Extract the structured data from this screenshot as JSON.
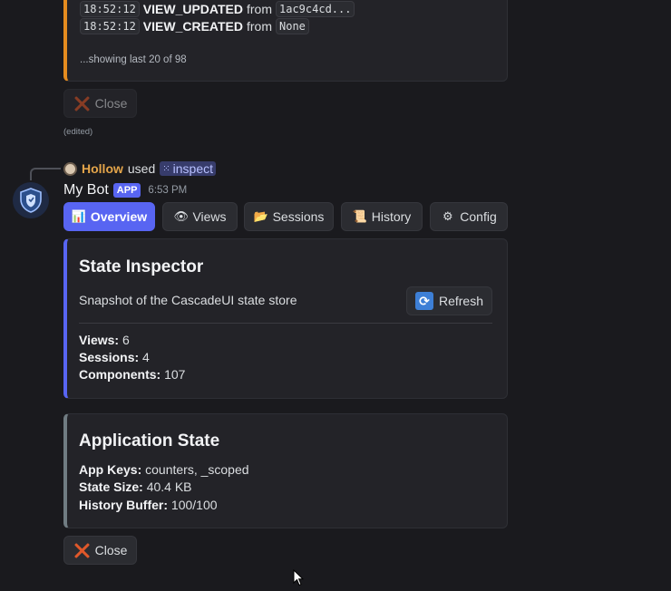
{
  "prev_embed": {
    "log": [
      {
        "time": "18:52:12",
        "event": "VIEW_UPDATED",
        "from": "from",
        "ref": "1ac9c4cd..."
      },
      {
        "time": "18:52:12",
        "event": "VIEW_CREATED",
        "from": "from",
        "ref": "None"
      }
    ],
    "showing": "...showing last 20 of 98",
    "close_label": "Close",
    "edited": "(edited)"
  },
  "reply": {
    "user": "Hollow",
    "used": "used",
    "command": "inspect"
  },
  "bot": {
    "name": "My Bot",
    "badge": "APP",
    "time": "6:53 PM"
  },
  "tabs": [
    {
      "label": "Overview",
      "icon": "bar-chart-icon",
      "active": true
    },
    {
      "label": "Views",
      "icon": "eye-icon",
      "active": false
    },
    {
      "label": "Sessions",
      "icon": "folder-icon",
      "active": false
    },
    {
      "label": "History",
      "icon": "scroll-icon",
      "active": false
    },
    {
      "label": "Config",
      "icon": "gear-icon",
      "active": false
    }
  ],
  "state_inspector": {
    "title": "State Inspector",
    "description": "Snapshot of the CascadeUI state store",
    "refresh_label": "Refresh",
    "fields": [
      {
        "label": "Views:",
        "value": "6"
      },
      {
        "label": "Sessions:",
        "value": "4"
      },
      {
        "label": "Components:",
        "value": "107"
      }
    ]
  },
  "application_state": {
    "title": "Application State",
    "fields": [
      {
        "label": "App Keys:",
        "value": "counters, _scoped"
      },
      {
        "label": "State Size:",
        "value": "40.4 KB"
      },
      {
        "label": "History Buffer:",
        "value": "100/100"
      }
    ]
  },
  "close_label": "Close",
  "colors": {
    "background": "#1a1a1e",
    "embed_bg": "#232328",
    "accent_blue": "#5865f2",
    "accent_orange": "#e58c1f",
    "accent_gray": "#707c82",
    "close_x": "#e0582a",
    "reply_user": "#e4a54a"
  }
}
